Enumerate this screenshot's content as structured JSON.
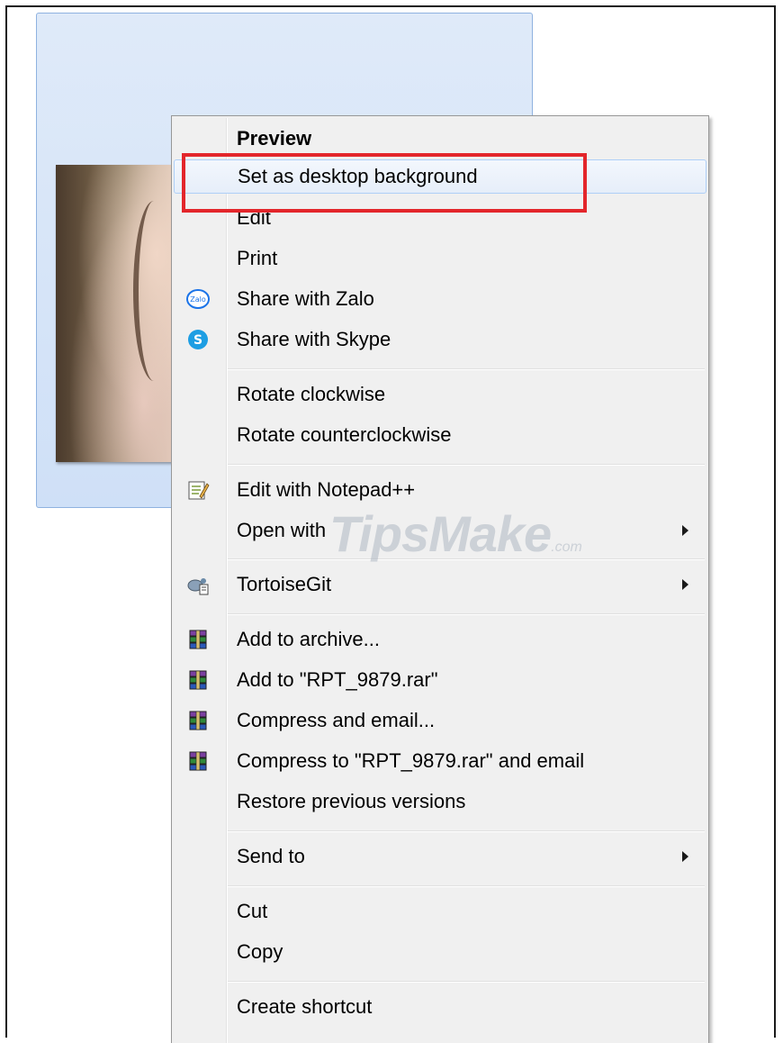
{
  "menu": {
    "items": [
      {
        "label": "Preview",
        "icon": "",
        "submenu": false,
        "bold": true
      },
      {
        "label": "Set as desktop background",
        "icon": "",
        "submenu": false,
        "hover": true
      },
      {
        "label": "Edit",
        "icon": "",
        "submenu": false
      },
      {
        "label": "Print",
        "icon": "",
        "submenu": false
      },
      {
        "label": "Share with Zalo",
        "icon": "zalo-icon",
        "submenu": false
      },
      {
        "label": "Share with Skype",
        "icon": "skype-icon",
        "submenu": false
      },
      {
        "label": "Rotate clockwise",
        "icon": "",
        "submenu": false
      },
      {
        "label": "Rotate counterclockwise",
        "icon": "",
        "submenu": false
      },
      {
        "label": "Edit with Notepad++",
        "icon": "notepad-plus-plus-icon",
        "submenu": false
      },
      {
        "label": "Open with",
        "icon": "",
        "submenu": true
      },
      {
        "label": "TortoiseGit",
        "icon": "tortoisegit-icon",
        "submenu": true
      },
      {
        "label": "Add to archive...",
        "icon": "winrar-icon",
        "submenu": false
      },
      {
        "label": "Add to \"RPT_9879.rar\"",
        "icon": "winrar-icon",
        "submenu": false
      },
      {
        "label": "Compress and email...",
        "icon": "winrar-icon",
        "submenu": false
      },
      {
        "label": "Compress to \"RPT_9879.rar\" and email",
        "icon": "winrar-icon",
        "submenu": false
      },
      {
        "label": "Restore previous versions",
        "icon": "",
        "submenu": false
      },
      {
        "label": "Send to",
        "icon": "",
        "submenu": true
      },
      {
        "label": "Cut",
        "icon": "",
        "submenu": false
      },
      {
        "label": "Copy",
        "icon": "",
        "submenu": false
      },
      {
        "label": "Create shortcut",
        "icon": "",
        "submenu": false
      }
    ],
    "zalo_icon_text": "Zalo",
    "skype_icon_text": "S"
  },
  "watermark": {
    "main": "TipsMake",
    "suffix": ".com"
  },
  "colors": {
    "highlight_border": "#e3262b",
    "hover_border": "#aecff7",
    "menu_bg": "#f0f0f0"
  }
}
